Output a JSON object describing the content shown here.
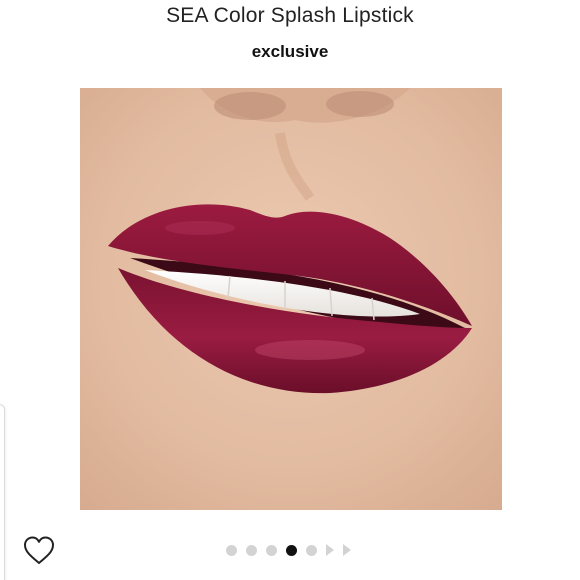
{
  "product": {
    "title": "SEA Color Splash Lipstick",
    "subtitle": "exclusive",
    "image_alt": "Model wearing berry red lipstick, close-up of lips",
    "lip_color": "#8a1538"
  },
  "like_button": {
    "icon": "heart-outline-icon",
    "liked": false
  },
  "carousel": {
    "dot_count": 5,
    "active_index": 3,
    "has_more_arrows": 2,
    "inactive_color": "#d3d3d3",
    "active_color": "#111111"
  }
}
